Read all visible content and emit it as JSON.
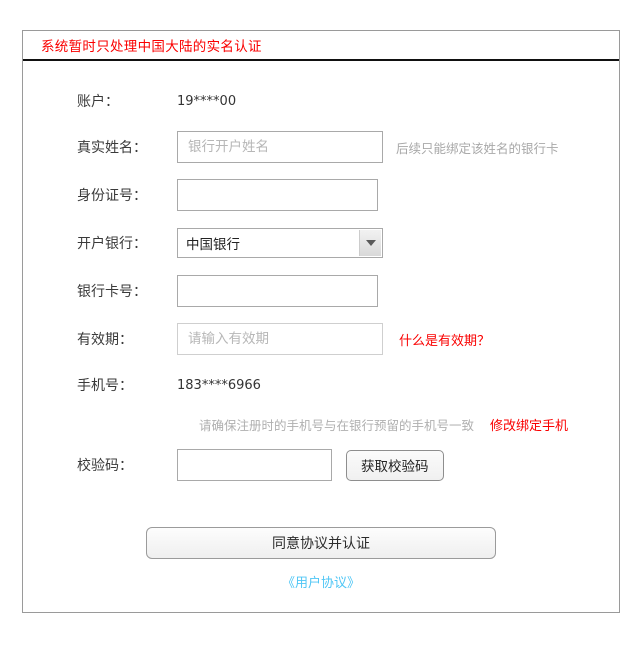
{
  "notice": {
    "text": "系统暂时只处理中国大陆的实名认证",
    "color": "#fa0000"
  },
  "form": {
    "account": {
      "label": "账户：",
      "value": "19****00"
    },
    "real_name": {
      "label": "真实姓名：",
      "value": "",
      "placeholder": "银行开户姓名",
      "hint": "后续只能绑定该姓名的银行卡"
    },
    "id_number": {
      "label": "身份证号：",
      "value": "",
      "placeholder": ""
    },
    "bank": {
      "label": "开户银行：",
      "selected": "中国银行",
      "arrow_icon": "chevron-down-icon"
    },
    "card_number": {
      "label": "银行卡号：",
      "value": "",
      "placeholder": ""
    },
    "expiry": {
      "label": "有效期：",
      "value": "",
      "placeholder": "请输入有效期",
      "help_link": "什么是有效期？",
      "help_color": "#fa0000"
    },
    "phone": {
      "label": "手机号：",
      "value": "183****6966",
      "note": "请确保注册时的手机号与在银行预留的手机号一致",
      "change_link": "修改绑定手机",
      "change_color": "#fa0000"
    },
    "verify_code": {
      "label": "校验码：",
      "value": "",
      "placeholder": "",
      "button_label": "获取校验码"
    }
  },
  "footer": {
    "submit_label": "同意协议并认证",
    "agreement_label": "《用户协议》",
    "agreement_color": "#4fc6f5"
  }
}
